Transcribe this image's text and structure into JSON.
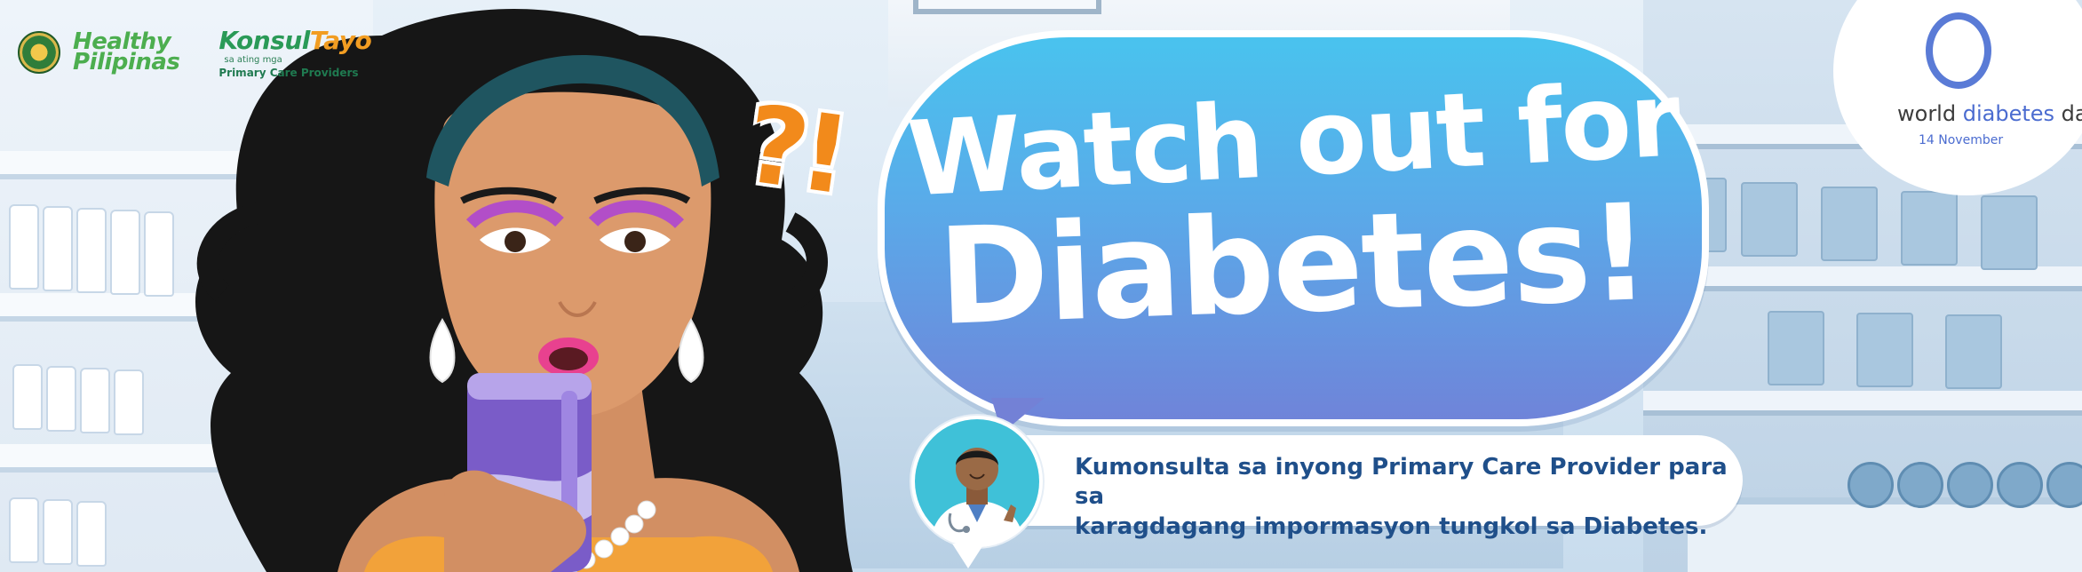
{
  "logos": {
    "healthy_pilipinas_line1": "Healthy",
    "healthy_pilipinas_line2": "Pilipinas",
    "konsultayo_konsul": "Konsul",
    "konsultayo_tayo": "Tayo",
    "konsultayo_small": "sa ating mga",
    "konsultayo_sub": "Primary Care Providers"
  },
  "exclamation": "?!",
  "headline": {
    "line1": "Watch out for",
    "line2": "Diabetes!"
  },
  "wdd": {
    "title_world": "world",
    "title_diabetes": "diabetes",
    "title_day": "day",
    "date": "14 November"
  },
  "info": {
    "line1": "Kumonsulta sa inyong Primary Care Provider para sa",
    "line2": "karagdagang impormasyon tungkol sa Diabetes."
  },
  "colors": {
    "bubble_top": "#49c3ee",
    "bubble_bottom": "#6f84d9",
    "headline": "#ffffff",
    "info_text": "#1f4f8a",
    "accent_orange": "#f28a1b",
    "wdd_blue": "#5a7bd6"
  }
}
